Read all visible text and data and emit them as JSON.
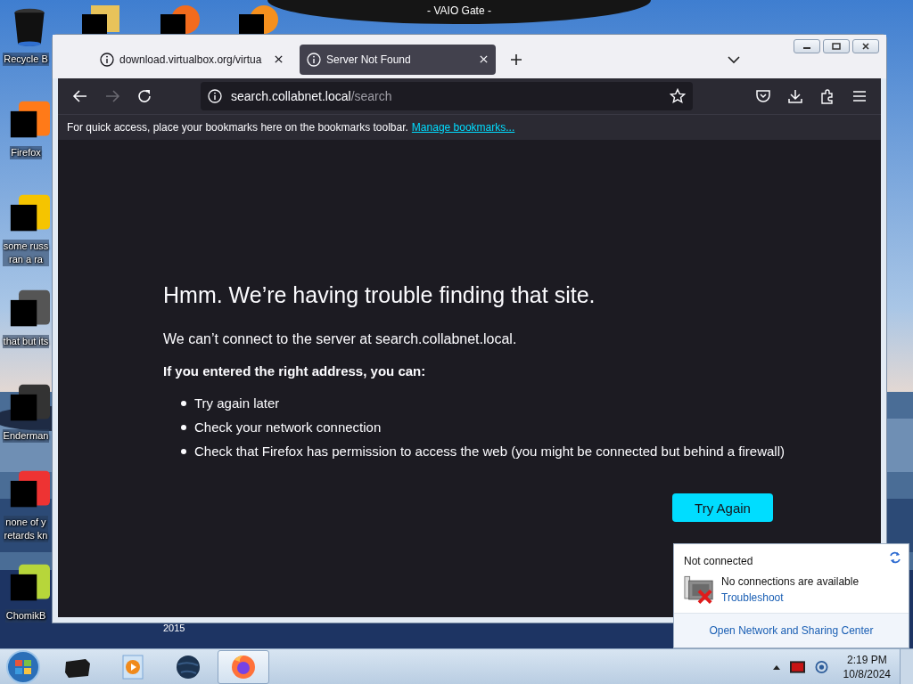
{
  "desktop": {
    "banner": "- VAIO Gate -",
    "top_icons": [
      {
        "kind": "folder"
      },
      {
        "kind": "orange-disc"
      },
      {
        "kind": "orange-ring"
      }
    ],
    "icons": [
      {
        "kind": "bin",
        "label": "Recycle B"
      },
      {
        "kind": "firefox",
        "label": "Firefox"
      },
      {
        "kind": "yellow",
        "label": "some russ\nran a ra"
      },
      {
        "kind": "windows",
        "label": "that but its"
      },
      {
        "kind": "terminal",
        "label": "Enderman"
      },
      {
        "kind": "red",
        "label": "none of y\nretards kn"
      },
      {
        "kind": "hamster",
        "label": "ChomikB"
      }
    ],
    "stray_text": "2015"
  },
  "browser": {
    "tabs": [
      {
        "title": "download.virtualbox.org/virtua",
        "selected": false
      },
      {
        "title": "Server Not Found",
        "selected": true
      }
    ],
    "forward_disabled": true,
    "address": {
      "host": "search.collabnet.local",
      "path": "/search"
    },
    "bookmarks_hint": "For quick access, place your bookmarks here on the bookmarks toolbar.",
    "bookmarks_link": "Manage bookmarks...",
    "error": {
      "title": "Hmm. We’re having trouble finding that site.",
      "message": "We can’t connect to the server at search.collabnet.local.",
      "subtitle": "If you entered the right address, you can:",
      "suggestions": [
        "Try again later",
        "Check your network connection",
        "Check that Firefox has permission to access the web (you might be connected but behind a firewall)"
      ],
      "button": "Try Again"
    }
  },
  "network_popup": {
    "status": "Not connected",
    "message": "No connections are available",
    "link": "Troubleshoot",
    "footer_link": "Open Network and Sharing Center"
  },
  "taskbar": {
    "apps": [
      {
        "kind": "box",
        "selected": false
      },
      {
        "kind": "media",
        "selected": false
      },
      {
        "kind": "globe",
        "selected": false
      },
      {
        "kind": "firefox",
        "selected": true
      }
    ],
    "time": "2:19 PM",
    "date": "10/8/2024"
  }
}
